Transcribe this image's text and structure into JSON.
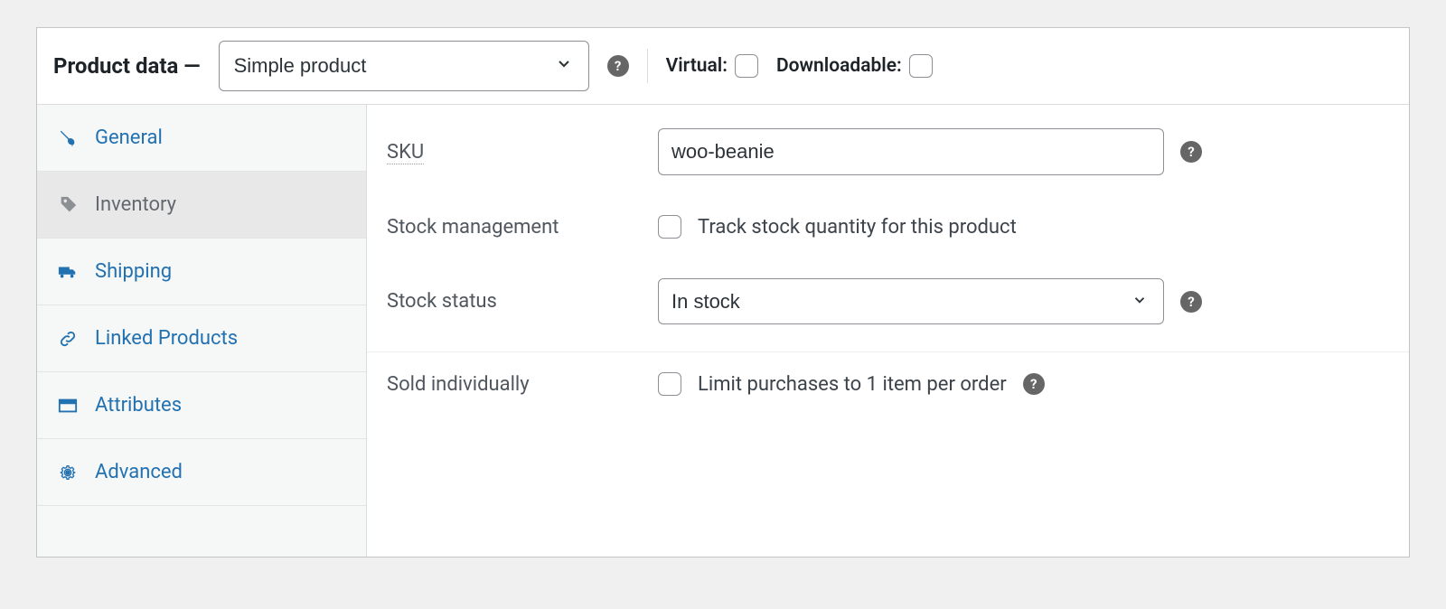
{
  "header": {
    "title": "Product data —",
    "type_selected": "Simple product",
    "virtual_label": "Virtual:",
    "downloadable_label": "Downloadable:"
  },
  "tabs": [
    {
      "key": "general",
      "label": "General",
      "icon": "wrench"
    },
    {
      "key": "inventory",
      "label": "Inventory",
      "icon": "tag"
    },
    {
      "key": "shipping",
      "label": "Shipping",
      "icon": "truck"
    },
    {
      "key": "linked",
      "label": "Linked Products",
      "icon": "link"
    },
    {
      "key": "attributes",
      "label": "Attributes",
      "icon": "card"
    },
    {
      "key": "advanced",
      "label": "Advanced",
      "icon": "gear"
    }
  ],
  "active_tab": "inventory",
  "inventory": {
    "sku_label": "SKU",
    "sku_value": "woo-beanie",
    "stock_mgmt_label": "Stock management",
    "stock_mgmt_desc": "Track stock quantity for this product",
    "stock_status_label": "Stock status",
    "stock_status_value": "In stock",
    "sold_individually_label": "Sold individually",
    "sold_individually_desc": "Limit purchases to 1 item per order"
  }
}
